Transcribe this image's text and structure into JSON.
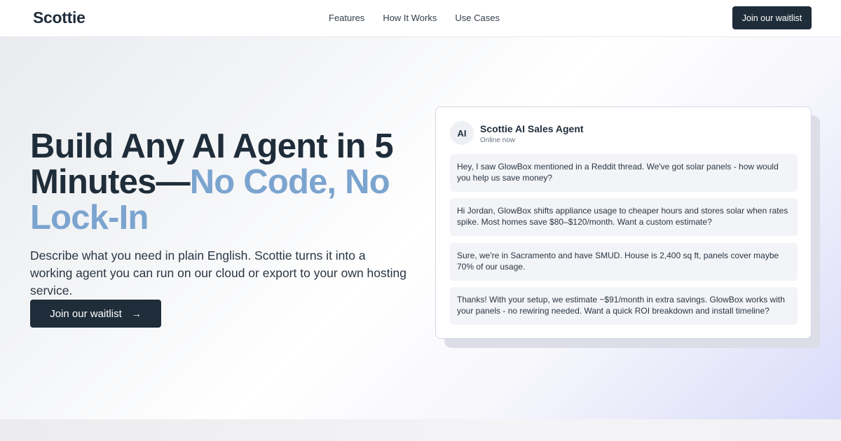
{
  "header": {
    "logo": "Scottie",
    "nav": [
      {
        "label": "Features"
      },
      {
        "label": "How It Works"
      },
      {
        "label": "Use Cases"
      }
    ],
    "cta_label": "Join our waitlist"
  },
  "hero": {
    "headline_part1": "Build Any AI Agent in 5 Minutes—",
    "headline_part2": "No Code, No Lock-In",
    "accent_color": "#7ba4cf",
    "subtext": "Describe what you need in plain English. Scottie turns it into a working agent you can run on our cloud or export to your own hosting service.",
    "cta_label": "Join our waitlist",
    "cta_icon": "arrow-right-icon"
  },
  "chat": {
    "avatar_text": "AI",
    "agent_name": "Scottie AI Sales Agent",
    "status": "Online now",
    "messages": [
      {
        "text": "Hey, I saw GlowBox mentioned in a Reddit thread. We've got solar panels - how would you help us save money?"
      },
      {
        "text": "Hi Jordan, GlowBox shifts appliance usage to cheaper hours and stores solar when rates spike. Most homes save $80–$120/month. Want a custom estimate?"
      },
      {
        "text": "Sure, we're in Sacramento and have SMUD. House is 2,400 sq ft, panels cover maybe 70% of our usage."
      },
      {
        "text": "Thanks! With your setup, we estimate ~$91/month in extra savings. GlowBox works with your panels - no rewiring needed. Want a quick ROI breakdown and install timeline?"
      }
    ]
  },
  "colors": {
    "primary": "#1f2d3a",
    "accent": "#7ba4cf"
  }
}
